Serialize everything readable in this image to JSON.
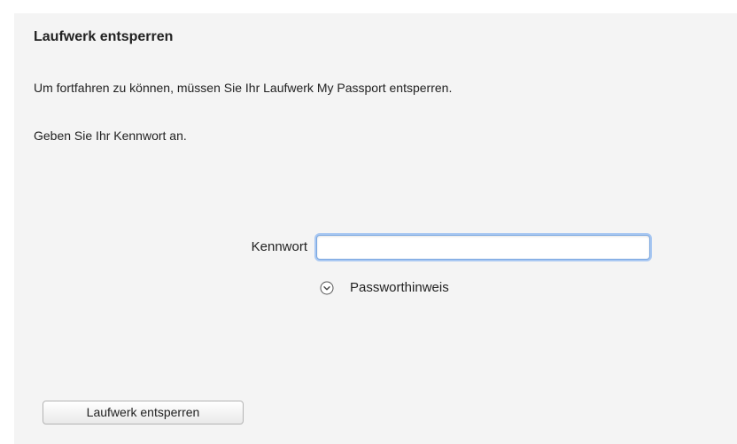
{
  "dialog": {
    "title": "Laufwerk entsperren",
    "message": "Um fortfahren zu können, müssen Sie Ihr Laufwerk My Passport entsperren.",
    "instruction": "Geben Sie Ihr Kennwort an."
  },
  "password": {
    "label": "Kennwort",
    "value": "",
    "placeholder": ""
  },
  "hint": {
    "label": "Passworthinweis",
    "icon": "chevron-down-circle-icon"
  },
  "actions": {
    "unlock_label": "Laufwerk entsperren"
  },
  "colors": {
    "panel_background": "#f4f4f4",
    "focus_ring": "#a9c8f2"
  }
}
